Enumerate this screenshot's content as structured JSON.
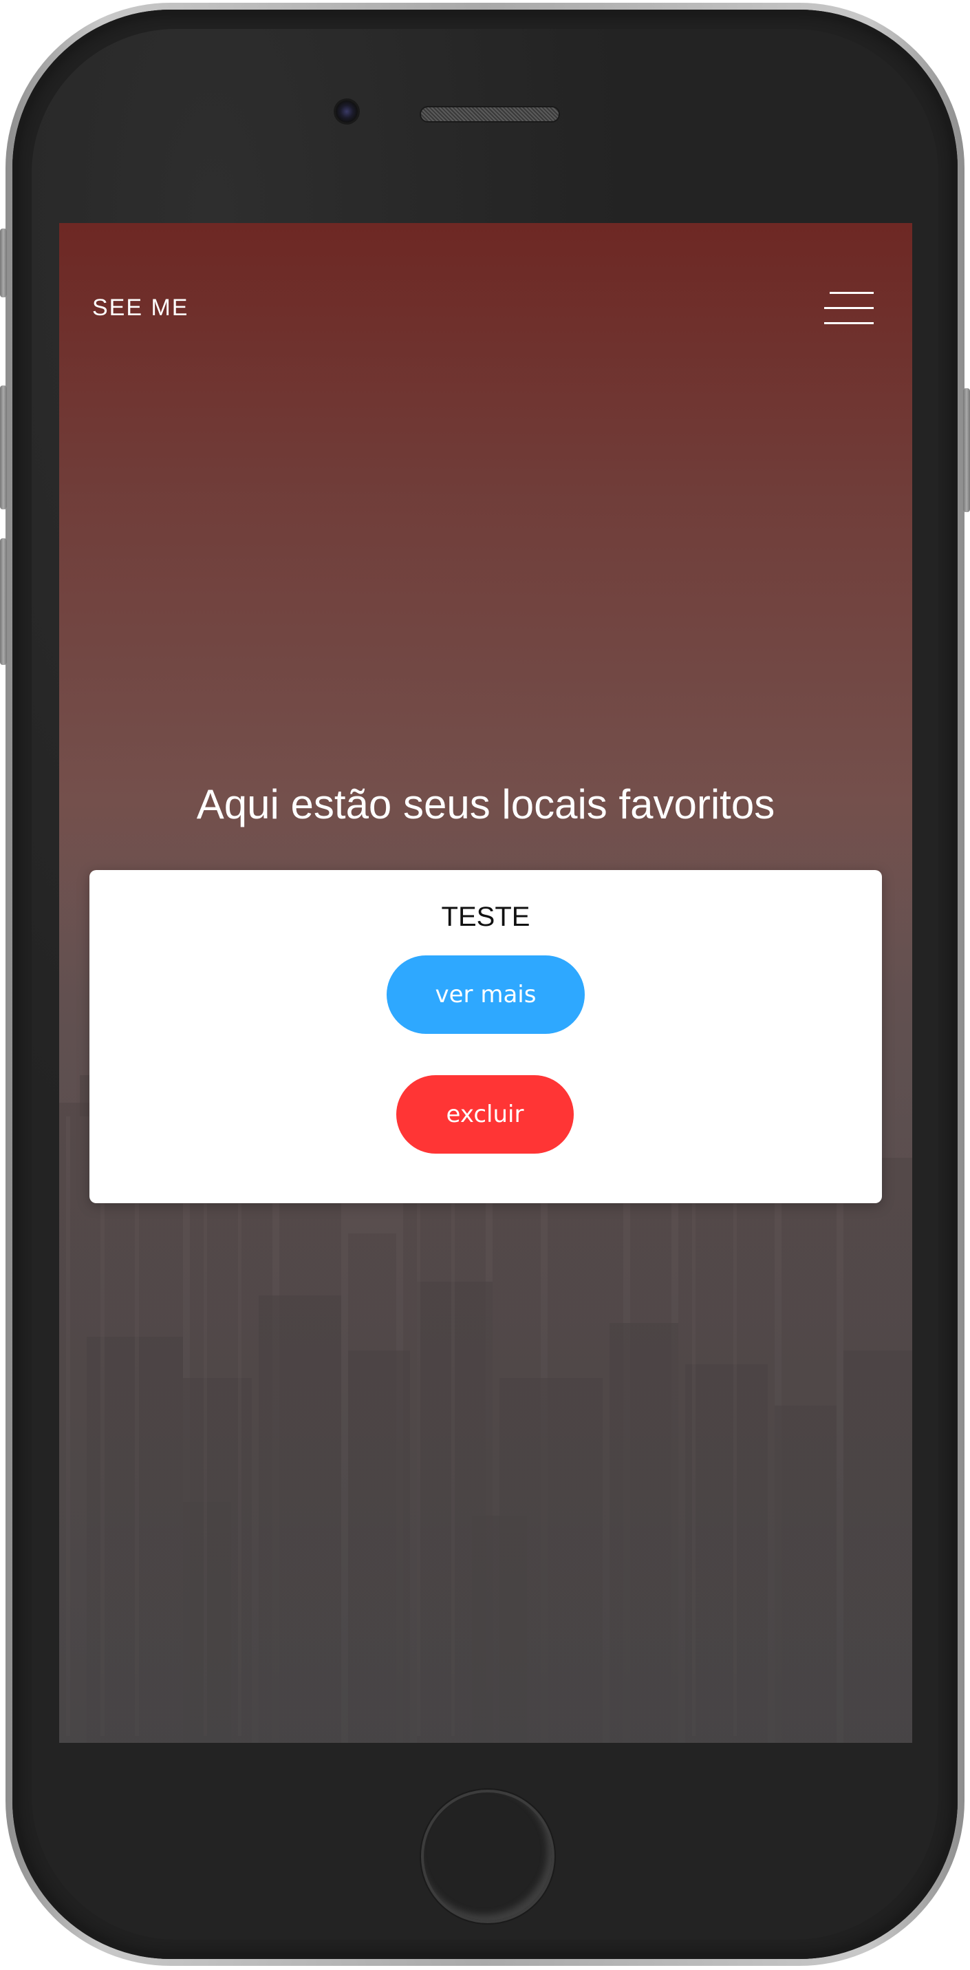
{
  "navbar": {
    "brand": "SEE ME",
    "menu_icon": "hamburger-icon"
  },
  "hero": {
    "heading": "Aqui estão seus locais favoritos"
  },
  "favorites": [
    {
      "title": "TESTE",
      "more_label": "ver mais",
      "delete_label": "excluir"
    }
  ],
  "colors": {
    "more_button": "#2ea8ff",
    "delete_button": "#ff3535",
    "hero_top": "#6e2824",
    "card_background": "#ffffff"
  },
  "background_image": "aerial-city-skyline"
}
